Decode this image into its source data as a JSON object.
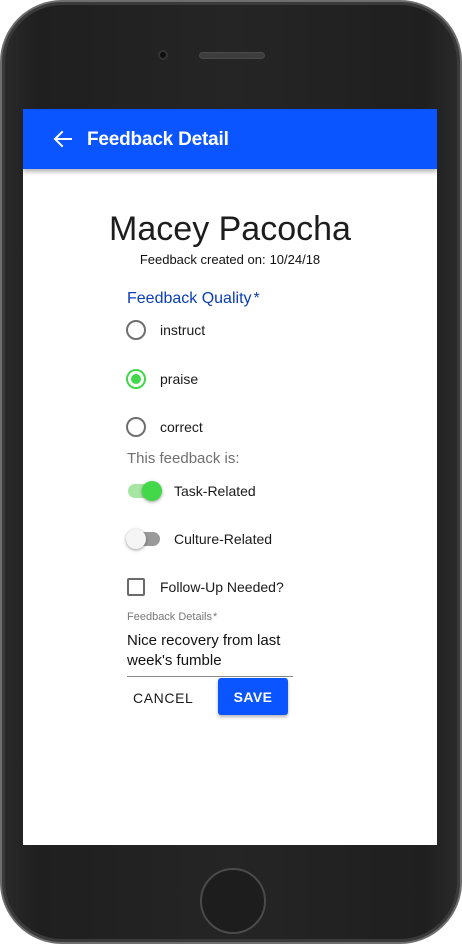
{
  "appbar": {
    "title": "Feedback Detail",
    "back_icon": "arrow-left-icon",
    "color": "#0a55ff"
  },
  "employee": {
    "name": "Macey Pacocha",
    "created_label": "Feedback created on:",
    "created_date": "10/24/18"
  },
  "quality": {
    "label": "Feedback Quality",
    "required_mark": "*",
    "options": [
      {
        "label": "instruct",
        "checked": false
      },
      {
        "label": "praise",
        "checked": true
      },
      {
        "label": "correct",
        "checked": false
      }
    ],
    "accent": "#43d84a"
  },
  "feedback_is": {
    "label": "This feedback is:",
    "toggles": [
      {
        "label": "Task-Related",
        "on": true
      },
      {
        "label": "Culture-Related",
        "on": false
      }
    ]
  },
  "follow_up": {
    "label": "Follow-Up Needed?",
    "checked": false
  },
  "details": {
    "label": "Feedback Details",
    "required_mark": "*",
    "value": "Nice recovery from last week's fumble"
  },
  "actions": {
    "cancel_label": "CANCEL",
    "save_label": "SAVE"
  }
}
